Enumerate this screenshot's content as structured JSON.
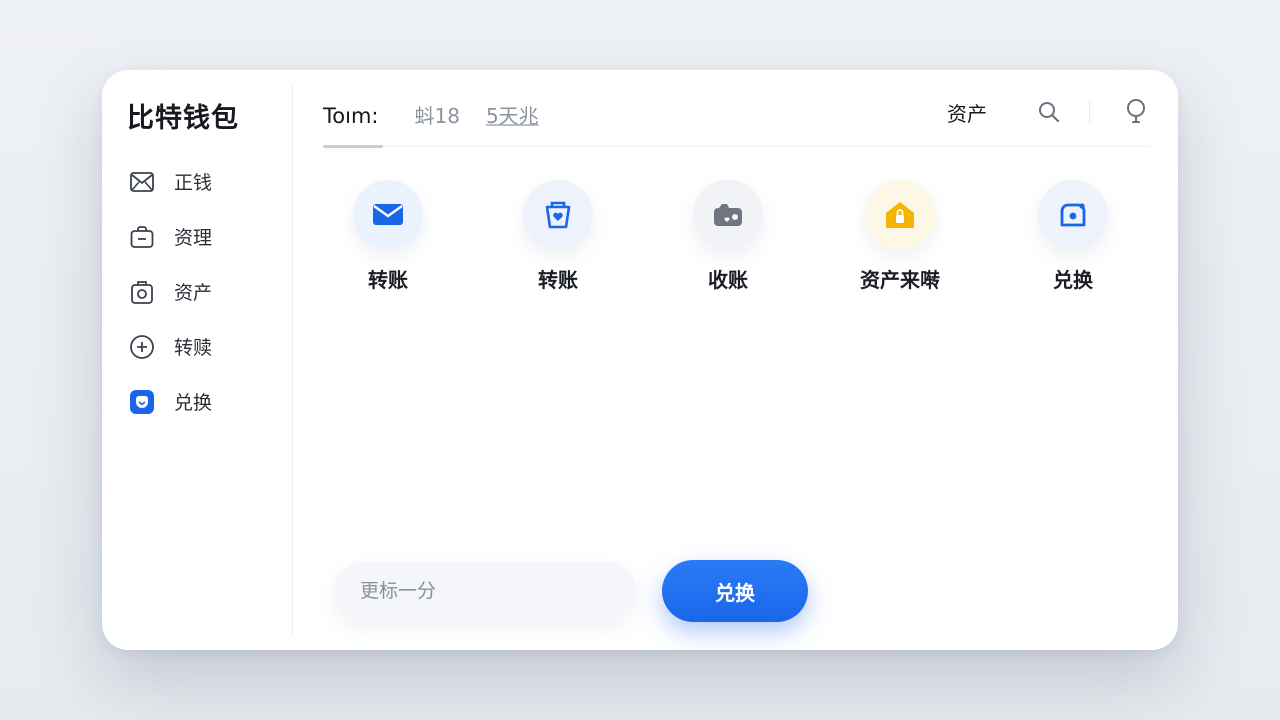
{
  "app": {
    "title": "比特钱包"
  },
  "sidebar": {
    "items": [
      {
        "label": "正钱",
        "icon": "mail-icon"
      },
      {
        "label": "资理",
        "icon": "briefcase-icon"
      },
      {
        "label": "资产",
        "icon": "camera-icon"
      },
      {
        "label": "转赎",
        "icon": "plus-circle-icon"
      },
      {
        "label": "兑换",
        "icon": "exchange-icon",
        "active": true
      }
    ]
  },
  "header": {
    "user": "Toım:",
    "meta_a": "蚪18",
    "meta_b": "5天兆",
    "assets_label": "资产",
    "search_icon": "search-icon",
    "bulb_icon": "lightbulb-icon"
  },
  "actions": [
    {
      "label": "转账",
      "icon": "envelope-icon",
      "color": "#1a66ea",
      "bg": "#eaf2fd"
    },
    {
      "label": "转账",
      "icon": "shield-heart-icon",
      "color": "#1a66ea",
      "bg": "#eef3fb"
    },
    {
      "label": "收账",
      "icon": "wallet-icon",
      "color": "#6f7682",
      "bg": "#f1f3f6"
    },
    {
      "label": "资产来啭",
      "icon": "home-lock-icon",
      "color": "#f5b400",
      "bg": "#fdf7e6"
    },
    {
      "label": "兑换",
      "icon": "camera-dot-icon",
      "color": "#1a66ea",
      "bg": "#eef3fb"
    }
  ],
  "footer": {
    "amount_placeholder": "更标一分",
    "exchange_label": "兑换"
  },
  "colors": {
    "accent": "#1a66ea",
    "warning": "#f5b400",
    "text": "#1b1f26",
    "muted": "#8c939d"
  }
}
